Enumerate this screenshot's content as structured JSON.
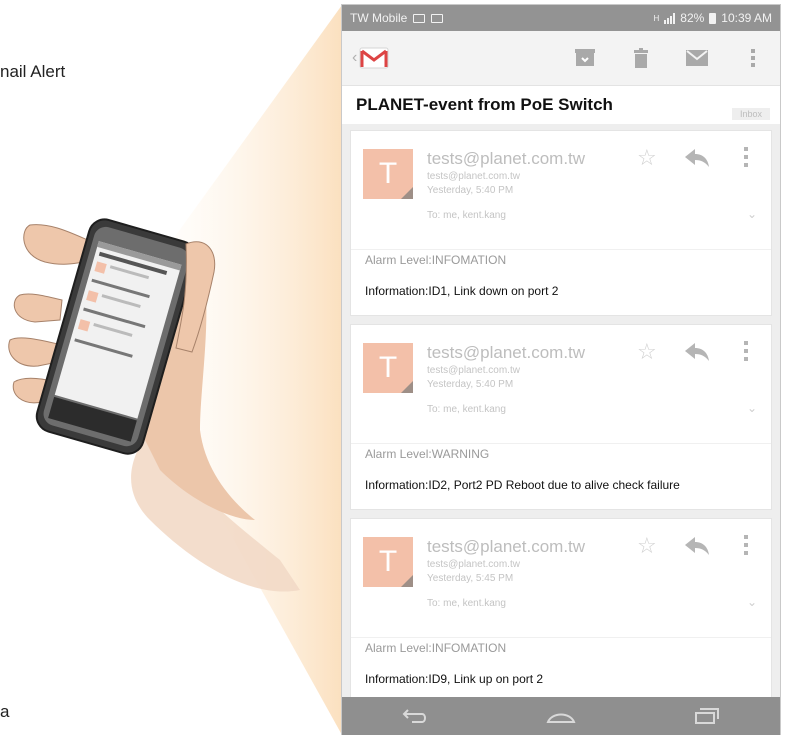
{
  "caption": {
    "left_text": "nail Alert",
    "bottom_letter": "a"
  },
  "colors": {
    "status_bar": "#939393",
    "avatar": "#f3c0a9",
    "beam": "#fbe3c3",
    "nav_bar": "#8f8f8f"
  },
  "status_bar": {
    "carrier": "TW Mobile",
    "left_icons": [
      "image-icon",
      "mail-icon"
    ],
    "network": "H",
    "battery": "82%",
    "time": "10:39 AM"
  },
  "action_bar": {
    "logo": "gmail-logo",
    "icons": [
      "archive-icon",
      "trash-icon",
      "mark-unread-icon",
      "overflow-menu-icon"
    ]
  },
  "subject": {
    "title": "PLANET-event from PoE Switch",
    "label": "Inbox"
  },
  "emails": [
    {
      "avatar_letter": "T",
      "sender": "tests@planet.com.tw",
      "sender_email": "tests@planet.com.tw",
      "date": "Yesterday, 5:40 PM",
      "to": "To: me, kent.kang",
      "alarm": "Alarm Level:INFOMATION",
      "information": "Information:ID1, Link down on port 2"
    },
    {
      "avatar_letter": "T",
      "sender": "tests@planet.com.tw",
      "sender_email": "tests@planet.com.tw",
      "date": "Yesterday, 5:40 PM",
      "to": "To: me, kent.kang",
      "alarm": "Alarm Level:WARNING",
      "information": "Information:ID2, Port2 PD Reboot due to alive check failure"
    },
    {
      "avatar_letter": "T",
      "sender": "tests@planet.com.tw",
      "sender_email": "tests@planet.com.tw",
      "date": "Yesterday, 5:45 PM",
      "to": "To: me, kent.kang",
      "alarm": "Alarm Level:INFOMATION",
      "information": "Information:ID9, Link up on port 2"
    }
  ],
  "nav_bar": {
    "icons": [
      "back-nav-icon",
      "home-nav-icon",
      "recent-apps-icon"
    ]
  }
}
